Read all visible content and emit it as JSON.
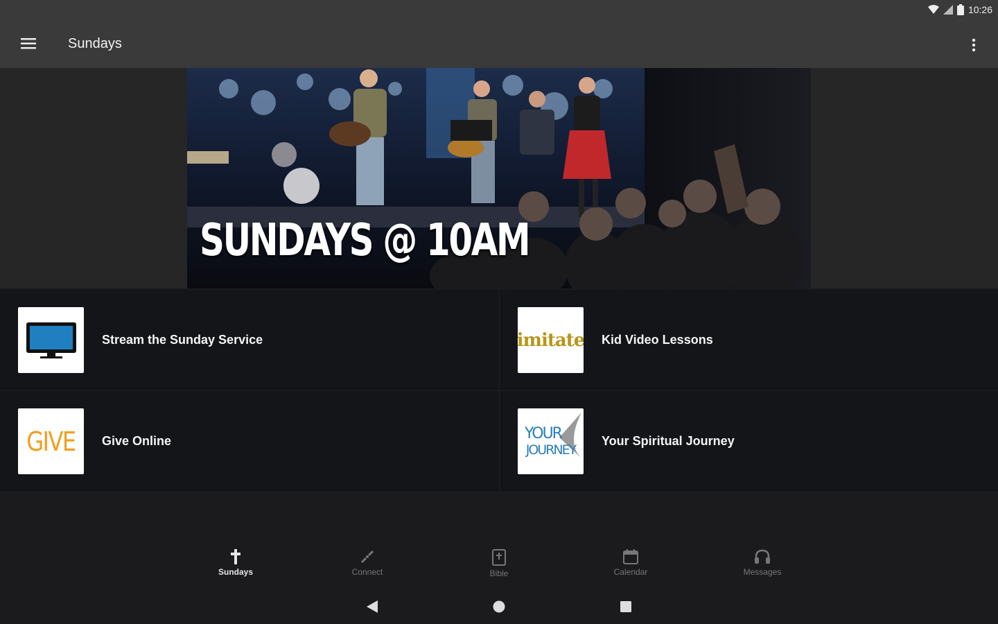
{
  "status_bar": {
    "time": "10:26",
    "icons": [
      "wifi-icon",
      "signal-icon",
      "battery-icon"
    ]
  },
  "app_bar": {
    "title": "Sundays",
    "menu_icon": "hamburger-menu-icon",
    "overflow_icon": "more-vert-icon"
  },
  "hero": {
    "text": "SUNDAYS @ 10AM"
  },
  "tiles": [
    {
      "label": "Stream the Sunday Service",
      "icon": "monitor-icon"
    },
    {
      "label": "Kid Video Lessons",
      "logo_text": "imitate"
    },
    {
      "label": "Give Online",
      "logo_text": "GIVE"
    },
    {
      "label": "Your Spiritual Journey",
      "logo_text": [
        "YOUR",
        "JOURNEY"
      ]
    }
  ],
  "bottom_nav": [
    {
      "label": "Sundays",
      "icon": "cross-icon",
      "active": true
    },
    {
      "label": "Connect",
      "icon": "connect-icon",
      "active": false
    },
    {
      "label": "Bible",
      "icon": "bible-icon",
      "active": false
    },
    {
      "label": "Calendar",
      "icon": "calendar-icon",
      "active": false
    },
    {
      "label": "Messages",
      "icon": "headphones-icon",
      "active": false
    }
  ],
  "system_nav": [
    "back-icon",
    "home-icon",
    "recents-icon"
  ],
  "colors": {
    "app_bar": "#3a3a3a",
    "tiles_bg": "#141518",
    "give_orange": "#f0a020",
    "imitate_gold": "#b8951a",
    "journey_blue": "#2a7fb8",
    "monitor_blue": "#1f7fc0"
  }
}
